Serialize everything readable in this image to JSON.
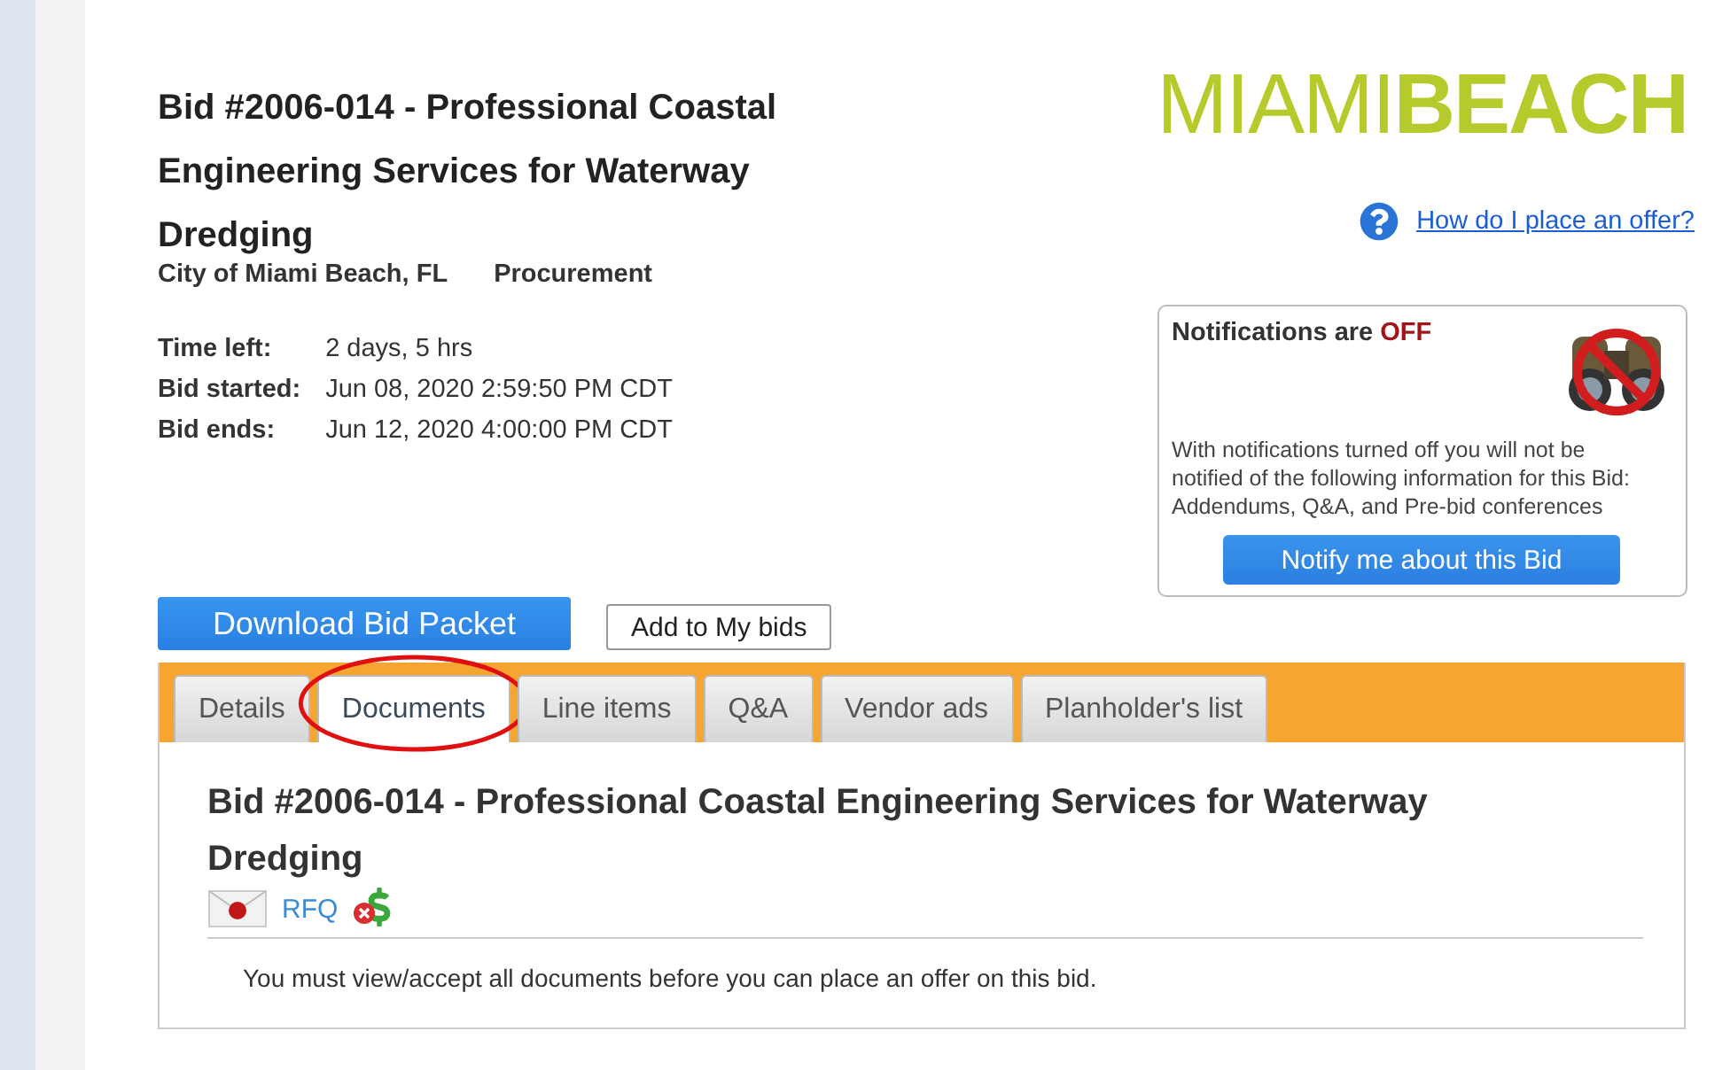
{
  "bid": {
    "title": "Bid #2006-014 - Professional Coastal Engineering Services for Waterway Dredging",
    "organization": "City of Miami Beach, FL",
    "department": "Procurement",
    "times": [
      {
        "label": "Time left:",
        "value": "2 days, 5 hrs"
      },
      {
        "label": "Bid started:",
        "value": "Jun 08, 2020 2:59:50 PM CDT"
      },
      {
        "label": "Bid ends:",
        "value": "Jun 12, 2020 4:00:00 PM CDT"
      }
    ]
  },
  "logo": {
    "light": "MIAMI",
    "bold": "BEACH"
  },
  "help_link": "How do I place an offer?",
  "notifications": {
    "heading": "Notifications are",
    "status": "OFF",
    "on": false,
    "message": "With notifications turned off you will not be notified of the following information for this Bid: Addendums, Q&A, and Pre-bid conferences",
    "button": "Notify me about this Bid"
  },
  "buttons": [
    {
      "label": "Download Bid Packet",
      "kind": "primary"
    },
    {
      "label": "Add to My bids",
      "kind": "secondary"
    }
  ],
  "tabs": [
    {
      "label": "Details",
      "selected": false,
      "circled": false
    },
    {
      "label": "Documents",
      "selected": true,
      "circled": true
    },
    {
      "label": "Line items",
      "selected": false,
      "circled": false
    },
    {
      "label": "Q&A",
      "selected": false,
      "circled": false
    },
    {
      "label": "Vendor ads",
      "selected": false,
      "circled": false
    },
    {
      "label": "Planholder's list",
      "selected": false,
      "circled": false
    }
  ],
  "panel": {
    "title": "Bid #2006-014 - Professional Coastal Engineering Services for Waterway Dredging",
    "document": "RFQ",
    "notice": "You must view/accept all documents before you can place an offer on this bid."
  }
}
